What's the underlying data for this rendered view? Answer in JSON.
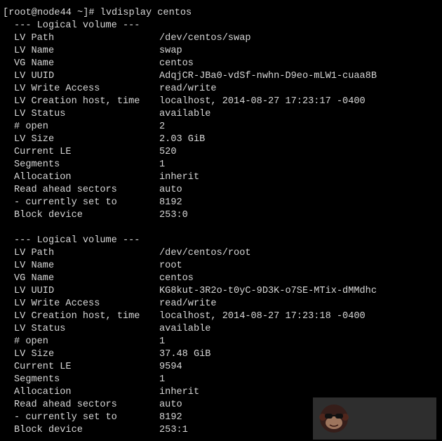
{
  "terminal": {
    "command_line": "[root@node44 ~]# lvdisplay centos",
    "volumes": [
      {
        "header": "--- Logical volume ---",
        "fields": [
          {
            "key": "LV Path",
            "value": "/dev/centos/swap"
          },
          {
            "key": "LV Name",
            "value": "swap"
          },
          {
            "key": "VG Name",
            "value": "centos"
          },
          {
            "key": "LV UUID",
            "value": "AdqjCR-JBa0-vdSf-nwhn-D9eo-mLW1-cuaa8B"
          },
          {
            "key": "LV Write Access",
            "value": "read/write"
          },
          {
            "key": "LV Creation host, time",
            "value": "localhost, 2014-08-27 17:23:17 -0400"
          },
          {
            "key": "LV Status",
            "value": "available"
          },
          {
            "key": "# open",
            "value": "2"
          },
          {
            "key": "LV Size",
            "value": "2.03 GiB"
          },
          {
            "key": "Current LE",
            "value": "520"
          },
          {
            "key": "Segments",
            "value": "1"
          },
          {
            "key": "Allocation",
            "value": "inherit"
          },
          {
            "key": "Read ahead sectors",
            "value": "auto"
          },
          {
            "key": "- currently set to",
            "value": "8192"
          },
          {
            "key": "Block device",
            "value": "253:0"
          }
        ]
      },
      {
        "header": "--- Logical volume ---",
        "fields": [
          {
            "key": "LV Path",
            "value": "/dev/centos/root"
          },
          {
            "key": "LV Name",
            "value": "root"
          },
          {
            "key": "VG Name",
            "value": "centos"
          },
          {
            "key": "LV UUID",
            "value": "KG8kut-3R2o-t0yC-9D3K-o7SE-MTix-dMMdhc"
          },
          {
            "key": "LV Write Access",
            "value": "read/write"
          },
          {
            "key": "LV Creation host, time",
            "value": "localhost, 2014-08-27 17:23:18 -0400"
          },
          {
            "key": "LV Status",
            "value": "available"
          },
          {
            "key": "# open",
            "value": "1"
          },
          {
            "key": "LV Size",
            "value": "37.48 GiB"
          },
          {
            "key": "Current LE",
            "value": "9594"
          },
          {
            "key": "Segments",
            "value": "1"
          },
          {
            "key": "Allocation",
            "value": "inherit"
          },
          {
            "key": "Read ahead sectors",
            "value": "auto"
          },
          {
            "key": "- currently set to",
            "value": "8192"
          },
          {
            "key": "Block device",
            "value": "253:1"
          }
        ]
      }
    ]
  },
  "watermark": {
    "icon": "monkey-sunglasses-logo-icon"
  },
  "colors": {
    "background": "#000000",
    "text": "#d7d7d7"
  }
}
